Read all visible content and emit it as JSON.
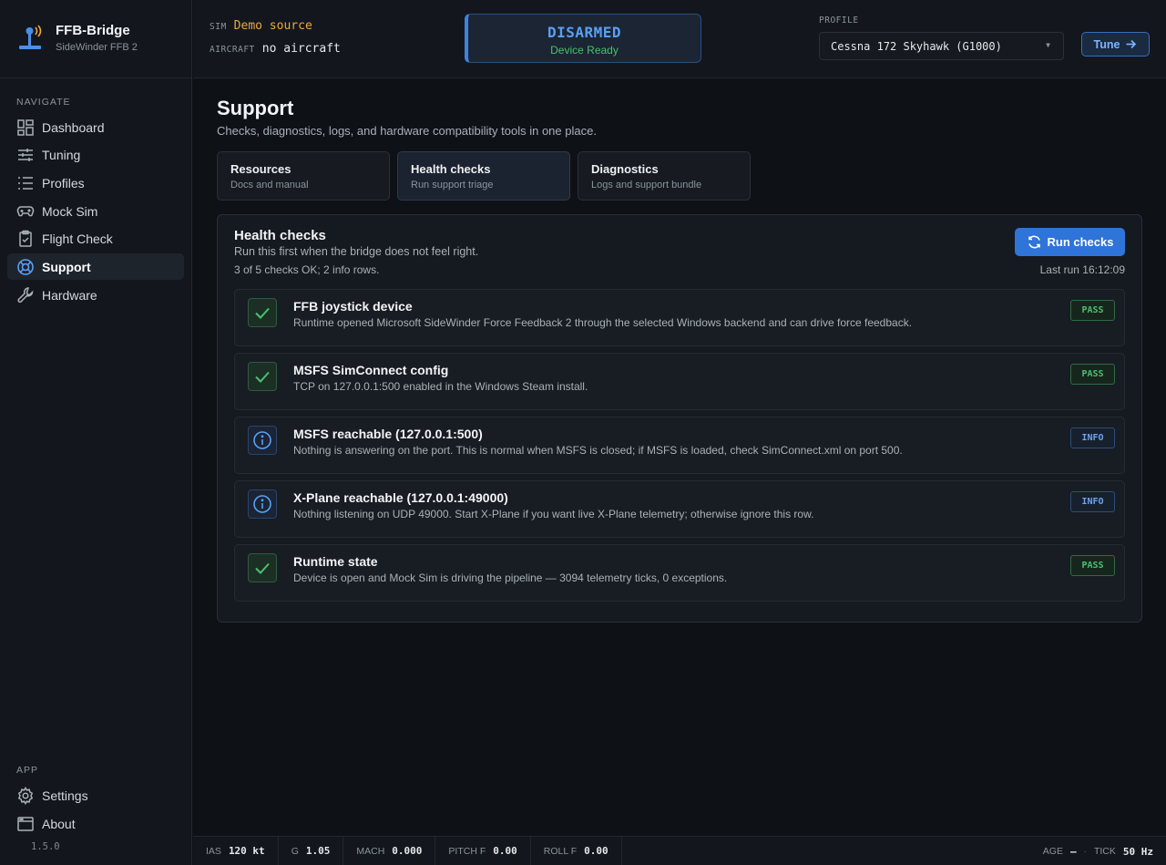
{
  "app": {
    "title": "FFB-Bridge",
    "subtitle": "SideWinder FFB 2",
    "version": "1.5.0"
  },
  "sidebar": {
    "nav_heading": "NAVIGATE",
    "items": [
      {
        "label": "Dashboard",
        "icon": "dashboard-icon"
      },
      {
        "label": "Tuning",
        "icon": "sliders-icon"
      },
      {
        "label": "Profiles",
        "icon": "list-icon"
      },
      {
        "label": "Mock Sim",
        "icon": "gamepad-icon"
      },
      {
        "label": "Flight Check",
        "icon": "clipboard-check-icon"
      },
      {
        "label": "Support",
        "icon": "lifebuoy-icon",
        "active": true
      },
      {
        "label": "Hardware",
        "icon": "wrench-icon"
      }
    ],
    "app_heading": "APP",
    "app_items": [
      {
        "label": "Settings",
        "icon": "gear-icon"
      },
      {
        "label": "About",
        "icon": "window-icon"
      }
    ]
  },
  "topbar": {
    "sim_label": "SIM",
    "sim_value": "Demo source",
    "aircraft_label": "AIRCRAFT",
    "aircraft_value": "no aircraft",
    "arm_state": "DISARMED",
    "arm_sub": "Device Ready",
    "profile_label": "PROFILE",
    "profile_value": "Cessna 172 Skyhawk (G1000)",
    "tune_label": "Tune"
  },
  "page": {
    "title": "Support",
    "subtitle": "Checks, diagnostics, logs, and hardware compatibility tools in one place.",
    "tabs": [
      {
        "title": "Resources",
        "sub": "Docs and manual"
      },
      {
        "title": "Health checks",
        "sub": "Run support triage",
        "active": true
      },
      {
        "title": "Diagnostics",
        "sub": "Logs and support bundle"
      }
    ]
  },
  "health": {
    "title": "Health checks",
    "subtitle": "Run this first when the bridge does not feel right.",
    "summary": "3 of 5 checks OK; 2 info rows.",
    "run_label": "Run checks",
    "last_run": "Last run 16:12:09",
    "checks": [
      {
        "title": "FFB joystick device",
        "desc": "Runtime opened Microsoft SideWinder Force Feedback 2 through the selected Windows backend and can drive force feedback.",
        "status": "PASS",
        "icon": "checkmark-icon"
      },
      {
        "title": "MSFS SimConnect config",
        "desc": "TCP on 127.0.0.1:500 enabled in the Windows Steam install.",
        "status": "PASS",
        "icon": "checkmark-icon"
      },
      {
        "title": "MSFS reachable (127.0.0.1:500)",
        "desc": "Nothing is answering on the port. This is normal when MSFS is closed; if MSFS is loaded, check SimConnect.xml on port 500.",
        "status": "INFO",
        "icon": "info-icon"
      },
      {
        "title": "X-Plane reachable (127.0.0.1:49000)",
        "desc": "Nothing listening on UDP 49000. Start X-Plane if you want live X-Plane telemetry; otherwise ignore this row.",
        "status": "INFO",
        "icon": "info-icon"
      },
      {
        "title": "Runtime state",
        "desc": "Device is open and Mock Sim is driving the pipeline — 3094 telemetry ticks, 0 exceptions.",
        "status": "PASS",
        "icon": "checkmark-icon"
      }
    ]
  },
  "statusbar": {
    "items": [
      {
        "k": "IAS",
        "v": "120 kt"
      },
      {
        "k": "G",
        "v": "1.05"
      },
      {
        "k": "MACH",
        "v": "0.000"
      },
      {
        "k": "PITCH F",
        "v": "0.00"
      },
      {
        "k": "ROLL F",
        "v": "0.00"
      }
    ],
    "age_label": "AGE",
    "age_value": "—",
    "separator": "·",
    "tick_label": "TICK",
    "tick_value": "50 Hz"
  },
  "colors": {
    "accent": "#2f74d9",
    "pass": "#49c06f",
    "info": "#6aa5f0",
    "sim_source": "#f0a73a"
  }
}
